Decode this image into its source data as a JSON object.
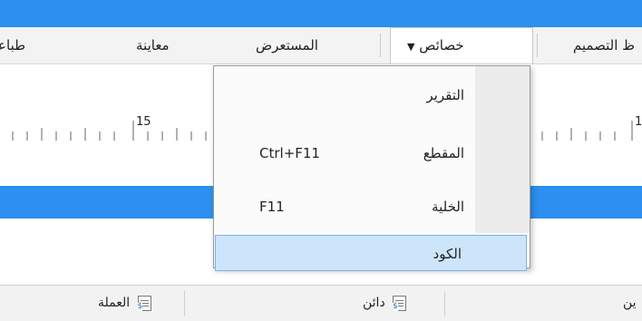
{
  "menubar": {
    "items": [
      {
        "label": "ظ التصميم"
      },
      {
        "label": "خصائص"
      },
      {
        "label": "المستعرض"
      },
      {
        "label": "معاينة"
      },
      {
        "label": "طباعة"
      }
    ]
  },
  "ruler": {
    "tick_label_left": "15",
    "tick_label_right": "1"
  },
  "dropdown": {
    "items": [
      {
        "label": "التقرير",
        "shortcut": ""
      },
      {
        "label": "المقطع",
        "shortcut": "Ctrl+F11"
      },
      {
        "label": "الخلية",
        "shortcut": "F11"
      },
      {
        "label": "الكود",
        "shortcut": ""
      }
    ]
  },
  "columns": [
    {
      "label": "العملة",
      "icon": "currency-doc-icon"
    },
    {
      "label": "دائن",
      "icon": "currency-doc-icon"
    },
    {
      "label": "ين"
    }
  ],
  "colors": {
    "accent": "#2d8ff0",
    "highlight": "#cde5fb"
  }
}
